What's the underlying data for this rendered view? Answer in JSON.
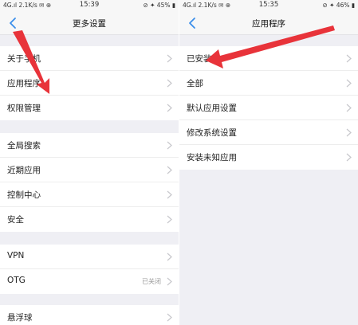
{
  "colors": {
    "accent": "#3b8eea",
    "annotation_arrow": "#e8333a",
    "page_bg": "#efeff4"
  },
  "left": {
    "status": {
      "network": "4G.ıl 2.1K/s ✉ ⊕",
      "time": "15:39",
      "battery": "⊘ ✦ 45% ▮"
    },
    "title": "更多设置",
    "back_icon": "chevron-left-icon",
    "group1": [
      {
        "label": "关于手机"
      },
      {
        "label": "应用程序"
      },
      {
        "label": "权限管理"
      }
    ],
    "group2": [
      {
        "label": "全局搜索"
      },
      {
        "label": "近期应用"
      },
      {
        "label": "控制中心"
      },
      {
        "label": "安全"
      }
    ],
    "group3": [
      {
        "label": "VPN"
      },
      {
        "label": "OTG",
        "value": "已关闭"
      }
    ],
    "group4": [
      {
        "label": "悬浮球"
      }
    ]
  },
  "right": {
    "status": {
      "network": "4G.ıl 2.1K/s ✉ ⊕",
      "time": "15:35",
      "battery": "⊘ ✦ 46% ▮"
    },
    "title": "应用程序",
    "back_icon": "chevron-left-icon",
    "items": [
      {
        "label": "已安装"
      },
      {
        "label": "全部"
      },
      {
        "label": "默认应用设置"
      },
      {
        "label": "修改系统设置"
      },
      {
        "label": "安装未知应用"
      }
    ]
  }
}
